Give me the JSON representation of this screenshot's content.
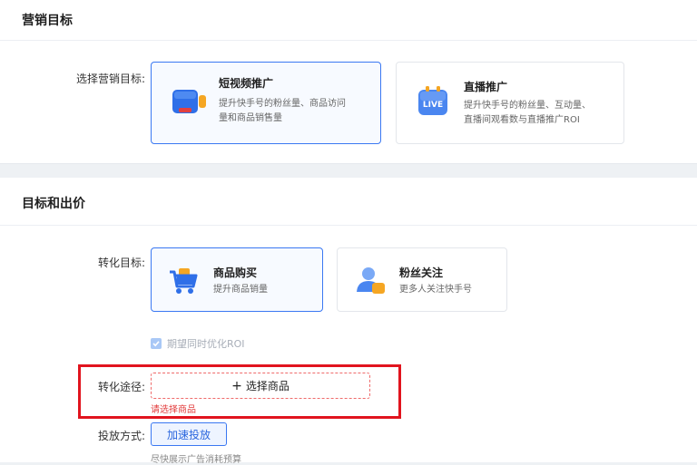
{
  "marketing": {
    "section_title": "营销目标",
    "field_label": "选择营销目标:",
    "cards": [
      {
        "title": "短视频推广",
        "desc_line1": "提升快手号的粉丝量、商品访问",
        "desc_line2": "量和商品销售量",
        "icon": "video-camera-icon"
      },
      {
        "title": "直播推广",
        "desc_line1": "提升快手号的粉丝量、互动量、",
        "desc_line2": "直播间观看数与直播推广ROI",
        "icon": "live-icon",
        "icon_text": "LIVE"
      }
    ]
  },
  "goal": {
    "section_title": "目标和出价",
    "field_label": "转化目标:",
    "cards": [
      {
        "title": "商品购买",
        "desc": "提升商品销量",
        "icon": "shopping-cart-icon"
      },
      {
        "title": "粉丝关注",
        "desc": "更多人关注快手号",
        "icon": "follower-icon"
      }
    ],
    "roi_checkbox_label": "期望同时优化ROI",
    "path_label": "转化途径:",
    "select_product_plus": "+",
    "select_product_label": "选择商品",
    "error_text": "请选择商品",
    "delivery_label": "投放方式:",
    "delivery_button": "加速投放",
    "delivery_desc": "尽快展示广告消耗预算"
  },
  "colors": {
    "accent": "#3a78f2",
    "error": "#e23b3b",
    "highlight": "#e1141e"
  }
}
